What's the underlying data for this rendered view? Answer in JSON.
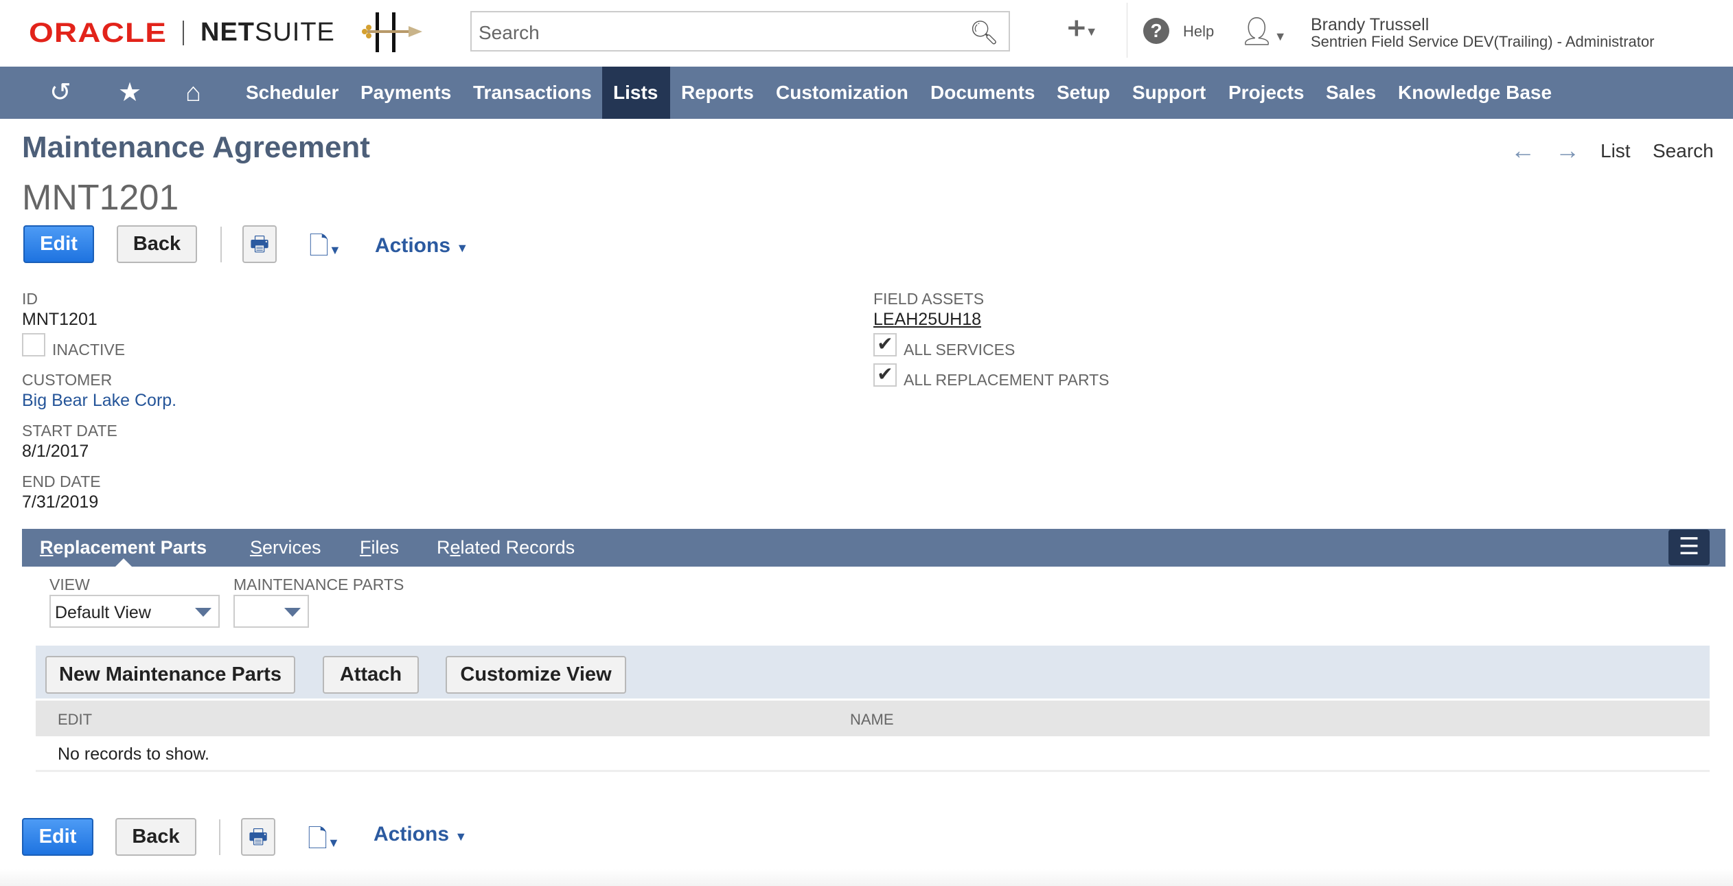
{
  "header": {
    "brand_oracle": "ORACLE",
    "brand_netsuite_bold": "NET",
    "brand_netsuite_light": "SUITE",
    "search_placeholder": "Search",
    "help_label": "Help",
    "user_name": "Brandy Trussell",
    "user_role": "Sentrien Field Service DEV(Trailing) - Administrator"
  },
  "nav": {
    "items": [
      "Scheduler",
      "Payments",
      "Transactions",
      "Lists",
      "Reports",
      "Customization",
      "Documents",
      "Setup",
      "Support",
      "Projects",
      "Sales",
      "Knowledge Base"
    ],
    "active": "Lists"
  },
  "page": {
    "title": "Maintenance Agreement",
    "record": "MNT1201",
    "list_link": "List",
    "search_link": "Search"
  },
  "toolbar": {
    "edit": "Edit",
    "back": "Back",
    "actions": "Actions"
  },
  "fields": {
    "id_label": "ID",
    "id_value": "MNT1201",
    "inactive_label": "INACTIVE",
    "inactive_checked": false,
    "customer_label": "CUSTOMER",
    "customer_value": "Big Bear Lake Corp.",
    "start_label": "START DATE",
    "start_value": "8/1/2017",
    "end_label": "END DATE",
    "end_value": "7/31/2019",
    "field_assets_label": "FIELD ASSETS",
    "field_assets_value": "LEAH25UH18",
    "all_services_label": "ALL SERVICES",
    "all_services_checked": true,
    "all_parts_label": "ALL REPLACEMENT PARTS",
    "all_parts_checked": true
  },
  "tabs": {
    "items": [
      {
        "first": "R",
        "rest": "eplacement Parts"
      },
      {
        "first": "S",
        "rest": "ervices"
      },
      {
        "first": "F",
        "rest": "iles"
      },
      {
        "pre": "R",
        "first": "e",
        "rest": "lated Records"
      }
    ],
    "active": "Replacement Parts"
  },
  "sublist": {
    "view_label": "VIEW",
    "view_value": "Default View",
    "parts_label": "MAINTENANCE PARTS",
    "parts_value": "",
    "buttons": [
      "New Maintenance Parts",
      "Attach",
      "Customize View"
    ],
    "columns": [
      "EDIT",
      "NAME"
    ],
    "empty": "No records to show."
  },
  "colors": {
    "nav": "#607799",
    "nav_active": "#243654",
    "primary": "#1e73e0",
    "link": "#255599"
  }
}
